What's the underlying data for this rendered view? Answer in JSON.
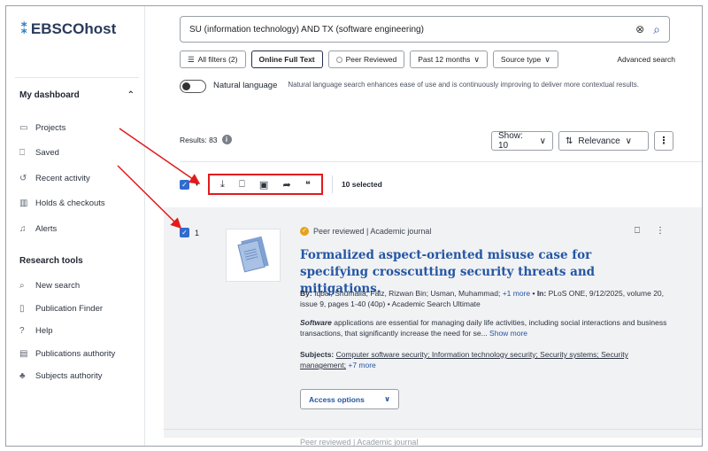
{
  "brand": {
    "logo_text": "EBSCOhost"
  },
  "sidebar": {
    "dashboard_heading": "My dashboard",
    "dashboard_items": [
      {
        "label": "Projects",
        "icon": "folder-icon"
      },
      {
        "label": "Saved",
        "icon": "bookmark-icon"
      },
      {
        "label": "Recent activity",
        "icon": "history-icon"
      },
      {
        "label": "Holds & checkouts",
        "icon": "books-icon"
      },
      {
        "label": "Alerts",
        "icon": "bell-icon"
      }
    ],
    "research_heading": "Research tools",
    "research_items": [
      {
        "label": "New search",
        "icon": "search-icon"
      },
      {
        "label": "Publication Finder",
        "icon": "document-icon"
      },
      {
        "label": "Help",
        "icon": "help-icon"
      },
      {
        "label": "Publications authority",
        "icon": "list-icon"
      },
      {
        "label": "Subjects authority",
        "icon": "hierarchy-icon"
      }
    ]
  },
  "search": {
    "query": "SU (information technology) AND TX (software engineering)"
  },
  "filters": {
    "all_filters": "All filters (2)",
    "online_full_text": "Online Full Text",
    "peer_reviewed": "Peer Reviewed",
    "date_range": "Past 12 months",
    "source_type": "Source type",
    "advanced_search": "Advanced search"
  },
  "natural_language": {
    "label": "Natural language",
    "description": "Natural language search enhances ease of use and is continuously improving to deliver more contextual results."
  },
  "results": {
    "count_label": "Results: 83",
    "show_label": "Show: 10",
    "sort_label": "Relevance",
    "selected_label": "10 selected"
  },
  "result": {
    "number": "1",
    "pub_type": "Peer reviewed | Academic journal",
    "title": "Formalized aspect-oriented misuse case for specifying crosscutting security threats and mitigations.",
    "by_prefix": "By:",
    "authors": "Iqbal, Shumaila; Faiz, Rizwan Bin; Usman, Muhammad;",
    "more_authors": "+1 more",
    "in_prefix": "• In:",
    "source": "PLoS ONE, 9/12/2025, volume 20, issue 9, pages 1-40 (40p) • Academic Search Ultimate",
    "abstract_em": "Software",
    "abstract_rest": " applications are essential for managing daily life activities, including social interactions and business transactions, that significantly increase the need for se...",
    "show_more": "Show more",
    "subjects_prefix": "Subjects:",
    "subjects_text": "Computer software security; Information technology security; Security systems; Security management;",
    "more_subjects": "+7 more",
    "access_options": "Access options",
    "next_pub_type": "Peer reviewed | Academic journal"
  },
  "colors": {
    "accent": "#2456a3",
    "checkbox": "#2f6ccf",
    "annotation": "#e21b1b",
    "peer_badge": "#e5a21c"
  }
}
